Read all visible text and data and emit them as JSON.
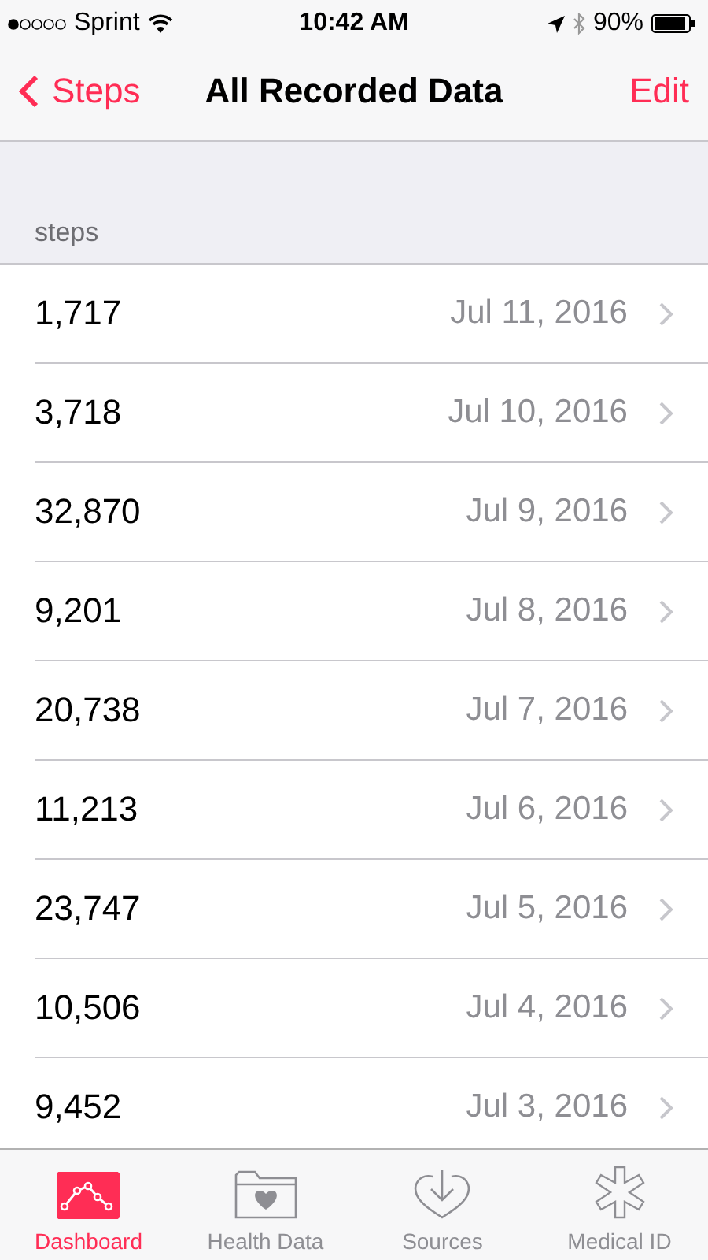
{
  "status_bar": {
    "carrier": "Sprint",
    "time": "10:42 AM",
    "battery": "90%"
  },
  "nav": {
    "back": "Steps",
    "title": "All Recorded Data",
    "action": "Edit"
  },
  "section": {
    "header": "steps"
  },
  "rows": [
    {
      "value": "1,717",
      "date": "Jul 11, 2016"
    },
    {
      "value": "3,718",
      "date": "Jul 10, 2016"
    },
    {
      "value": "32,870",
      "date": "Jul 9, 2016"
    },
    {
      "value": "9,201",
      "date": "Jul 8, 2016"
    },
    {
      "value": "20,738",
      "date": "Jul 7, 2016"
    },
    {
      "value": "11,213",
      "date": "Jul 6, 2016"
    },
    {
      "value": "23,747",
      "date": "Jul 5, 2016"
    },
    {
      "value": "10,506",
      "date": "Jul 4, 2016"
    },
    {
      "value": "9,452",
      "date": "Jul 3, 2016"
    }
  ],
  "tab_bar": [
    {
      "kind": "dashboard",
      "label": "Dashboard",
      "selected": true
    },
    {
      "kind": "health",
      "label": "Health Data",
      "selected": false
    },
    {
      "kind": "sources",
      "label": "Sources",
      "selected": false
    },
    {
      "kind": "medical",
      "label": "Medical ID",
      "selected": false
    }
  ]
}
